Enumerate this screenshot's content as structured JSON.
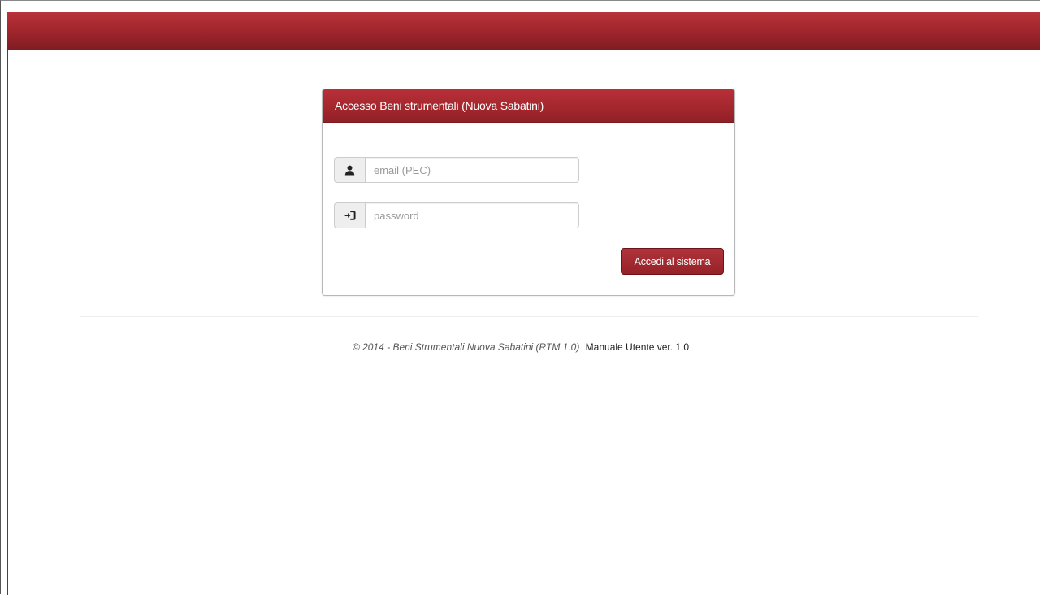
{
  "panel": {
    "title": "Accesso Beni strumentali (Nuova Sabatini)"
  },
  "login": {
    "email_placeholder": "email (PEC)",
    "email_value": "",
    "password_placeholder": "password",
    "password_value": "",
    "submit_label": "Accedi al sistema",
    "email_icon": "user-icon",
    "password_icon": "login-icon"
  },
  "footer": {
    "copyright": "© 2014 - Beni Strumentali Nuova Sabatini (RTM 1.0)",
    "manual_link": "Manuale Utente ver. 1.0"
  },
  "colors": {
    "brand_red": "#a3262d",
    "brand_red_dark": "#7e1c22"
  }
}
